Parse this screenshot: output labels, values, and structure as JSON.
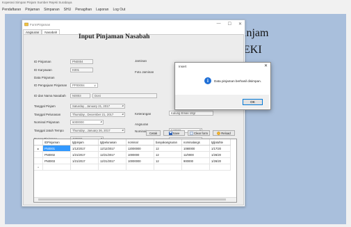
{
  "app": {
    "title": "Koperasi Simpan Pinjam Sumber Rejeki Surabaya"
  },
  "menu": [
    "Pendaftaran",
    "Pinjaman",
    "Simpanan",
    "SHU",
    "Penagihan",
    "Laporan",
    "Log Out"
  ],
  "background_text": {
    "line1": "injam",
    "line2": "EKI"
  },
  "window": {
    "title": "FormPinjaman",
    "controls": {
      "minimize": "—",
      "maximize": "☐",
      "close": "✕"
    },
    "tabs": [
      "Angsuran",
      "Nasabah"
    ],
    "active_tab": "Nasabah"
  },
  "form": {
    "title": "Input Pinjaman Nasabah",
    "labels": {
      "id_pinjaman": "ID Pinjaman",
      "id_karyawan": "ID Karyawan",
      "data_pinjaman": "Data Pinjaman",
      "id_pengajuan": "ID Pengajuan Pinjaman",
      "id_nama_nasabah": "ID dan Nama Nasabah",
      "tanggal_pinjam": "Tanggal Pinjam",
      "tanggal_pelunasan": "Tanggal Pelunasan",
      "nominal_pinjaman": "Nominal Pinjaman",
      "tanggal_jatuh_tempo": "Tanggal Jatuh Tempo",
      "bunga_pinjaman": "Bunga Pinjaman",
      "jaminan": "Jaminan",
      "foto_jaminan": "Foto Jaminan",
      "keterangan": "Keterangan",
      "angsuran": "Angsuran",
      "nominal_angsuran": "Nominal Angsuran",
      "banyak_angsuran": "Banyak Angsuran"
    },
    "values": {
      "id_pinjaman": "PN0004",
      "id_karyawan": "K001",
      "id_pengajuan": "PP00004",
      "id_nasabah": "N0003",
      "nama_nasabah": "Doni",
      "tanggal_pinjam": "Saturday ,  January  21, 2017",
      "tanggal_pelunasan": "Thursday ,  December 21, 2017",
      "nominal_pinjaman": "6000000",
      "tanggal_jatuh_tempo": "Thursday ,  January  26, 2017",
      "bunga_pinjaman": "480000",
      "keterangan": "Kalung Emas 10gr",
      "nominal_angsuran": "540000",
      "banyak_angsuran": "12"
    },
    "buttons": {
      "cetak": "Cetak",
      "save": "Save",
      "clear_form": "Clear form",
      "reload": "Reload"
    }
  },
  "grid": {
    "columns": [
      "IDPinjaman",
      "tglpinjam",
      "tglpelunasan",
      "nominal",
      "banyakangsuran",
      "nominalangs",
      "tgljatuhte"
    ],
    "rows": [
      [
        "PN0001",
        "1/12/2017",
        "12/12/2017",
        "12000000",
        "12",
        "1080000",
        "1/17/20"
      ],
      [
        "PN0002",
        "1/21/2017",
        "12/21/2017",
        "1000000",
        "12",
        "11/0000",
        "1/26/20"
      ],
      [
        "PN0003",
        "1/21/2017",
        "12/21/2017",
        "10000000",
        "12",
        "900000",
        "1/26/20"
      ]
    ],
    "selected_row": 0,
    "new_row_marker": "*",
    "current_row_marker": "▸"
  },
  "dialog": {
    "title": "Insert",
    "message": "Data pinjaman berhasil disimpan.",
    "ok": "OK",
    "close": "✕",
    "icon": "info-icon"
  }
}
